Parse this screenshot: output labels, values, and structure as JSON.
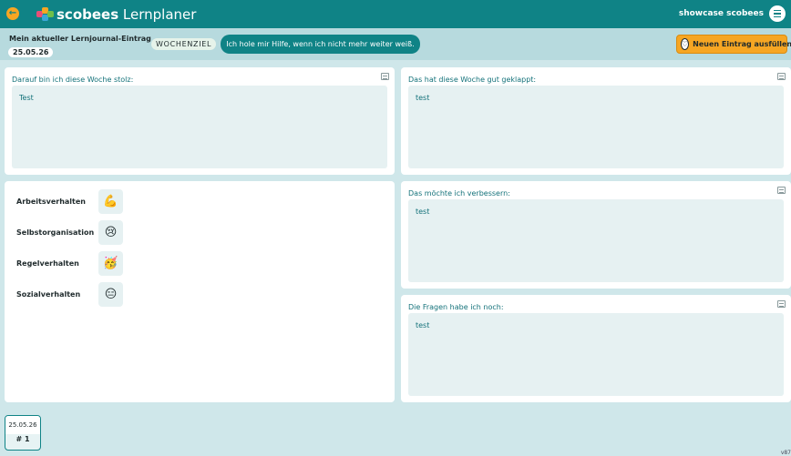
{
  "app": {
    "logo_bold": "scobees",
    "logo_regular": "Lernplaner",
    "user_name": "showcase scobees",
    "back_icon": "back-arrow-icon",
    "menu_icon": "hamburger-menu-icon"
  },
  "entry": {
    "title": "Mein aktueller Lernjournal-Eintrag",
    "date": "25.05.26",
    "wochenziel_label": "WOCHENZIEL",
    "wochenziel_text": "Ich hole mir Hilfe, wenn ich nicht mehr weiter weiß.",
    "new_entry_label": "Neuen Eintrag ausfüllen"
  },
  "cards": {
    "stolz": {
      "title": "Darauf bin ich diese Woche stolz:",
      "value": "Test"
    },
    "geklappt": {
      "title": "Das hat diese Woche gut geklappt:",
      "value": "test"
    },
    "verbessern": {
      "title": "Das möchte ich verbessern:",
      "value": "test"
    },
    "fragen": {
      "title": "Die Fragen habe ich noch:",
      "value": "test"
    }
  },
  "behaviour": {
    "items": [
      {
        "label": "Arbeitsverhalten",
        "emoji": "💪"
      },
      {
        "label": "Selbstorganisation",
        "emoji": "😢"
      },
      {
        "label": "Regelverhalten",
        "emoji": "🥳"
      },
      {
        "label": "Sozialverhalten",
        "emoji": "😑"
      }
    ]
  },
  "history": {
    "tab_date": "25.05.26",
    "tab_number": "# 1"
  },
  "version": "v87",
  "colors": {
    "teal": "#0f8386",
    "accent_orange": "#f6a623",
    "background": "#cfe7ea"
  }
}
